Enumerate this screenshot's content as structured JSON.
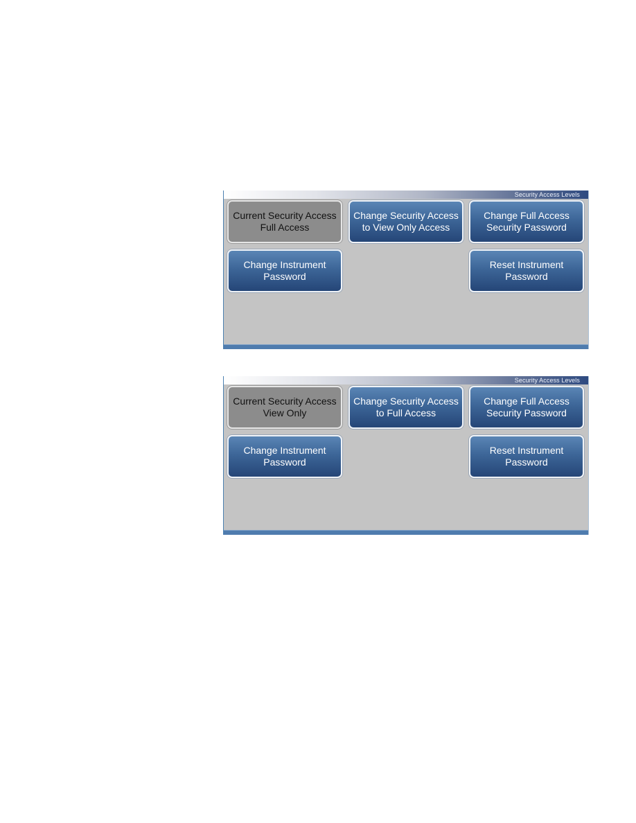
{
  "screens": [
    {
      "title": "Security Access Levels",
      "current_access": {
        "line1": "Current Security Access",
        "line2": "Full Access"
      },
      "change_access": {
        "line1": "Change Security Access",
        "line2": "to View Only Access"
      },
      "change_full_password": {
        "line1": "Change Full Access",
        "line2": "Security Password"
      },
      "change_instrument_password": {
        "line1": "Change Instrument",
        "line2": "Password"
      },
      "reset_instrument_password": {
        "line1": "Reset Instrument",
        "line2": "Password"
      }
    },
    {
      "title": "Security Access Levels",
      "current_access": {
        "line1": "Current Security Access",
        "line2": "View Only"
      },
      "change_access": {
        "line1": "Change Security Access",
        "line2": "to Full Access"
      },
      "change_full_password": {
        "line1": "Change Full Access",
        "line2": "Security Password"
      },
      "change_instrument_password": {
        "line1": "Change Instrument",
        "line2": "Password"
      },
      "reset_instrument_password": {
        "line1": "Reset Instrument",
        "line2": "Password"
      }
    }
  ],
  "colors": {
    "button_blue_top": "#5a85b5",
    "button_blue_bottom": "#254677",
    "button_current_gray": "#8c8c8c",
    "screen_background": "#c4c4c4",
    "bottom_bar": "#4f7cae"
  }
}
